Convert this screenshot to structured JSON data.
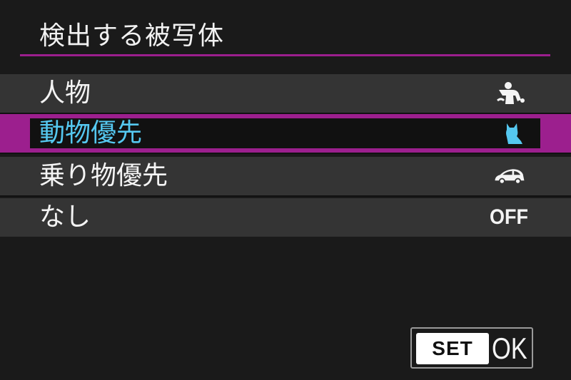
{
  "screen": {
    "title": "検出する被写体"
  },
  "options": [
    {
      "label": "人物",
      "icon": "person-icon",
      "selected": false
    },
    {
      "label": "動物優先",
      "icon": "animal-icon",
      "selected": true
    },
    {
      "label": "乗り物優先",
      "icon": "vehicle-icon",
      "selected": false
    },
    {
      "label": "なし",
      "value_text": "OFF",
      "selected": false
    }
  ],
  "footer": {
    "set_label": "SET",
    "ok_label": "OK"
  },
  "colors": {
    "accent": "#9c1f8e",
    "selected_text": "#55c8f0",
    "background": "#1a1a1a",
    "row_background": "#343434"
  }
}
